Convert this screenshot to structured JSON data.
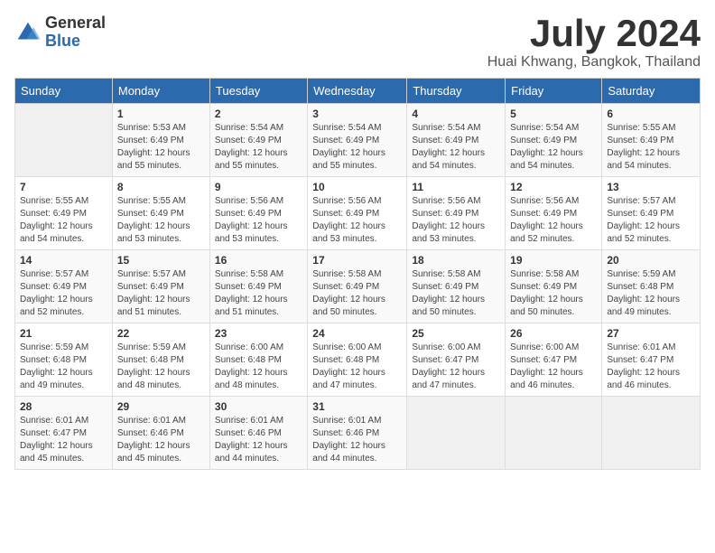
{
  "header": {
    "logo_general": "General",
    "logo_blue": "Blue",
    "month": "July 2024",
    "location": "Huai Khwang, Bangkok, Thailand"
  },
  "weekdays": [
    "Sunday",
    "Monday",
    "Tuesday",
    "Wednesday",
    "Thursday",
    "Friday",
    "Saturday"
  ],
  "weeks": [
    [
      {
        "day": "",
        "info": ""
      },
      {
        "day": "1",
        "info": "Sunrise: 5:53 AM\nSunset: 6:49 PM\nDaylight: 12 hours\nand 55 minutes."
      },
      {
        "day": "2",
        "info": "Sunrise: 5:54 AM\nSunset: 6:49 PM\nDaylight: 12 hours\nand 55 minutes."
      },
      {
        "day": "3",
        "info": "Sunrise: 5:54 AM\nSunset: 6:49 PM\nDaylight: 12 hours\nand 55 minutes."
      },
      {
        "day": "4",
        "info": "Sunrise: 5:54 AM\nSunset: 6:49 PM\nDaylight: 12 hours\nand 54 minutes."
      },
      {
        "day": "5",
        "info": "Sunrise: 5:54 AM\nSunset: 6:49 PM\nDaylight: 12 hours\nand 54 minutes."
      },
      {
        "day": "6",
        "info": "Sunrise: 5:55 AM\nSunset: 6:49 PM\nDaylight: 12 hours\nand 54 minutes."
      }
    ],
    [
      {
        "day": "7",
        "info": "Sunrise: 5:55 AM\nSunset: 6:49 PM\nDaylight: 12 hours\nand 54 minutes."
      },
      {
        "day": "8",
        "info": "Sunrise: 5:55 AM\nSunset: 6:49 PM\nDaylight: 12 hours\nand 53 minutes."
      },
      {
        "day": "9",
        "info": "Sunrise: 5:56 AM\nSunset: 6:49 PM\nDaylight: 12 hours\nand 53 minutes."
      },
      {
        "day": "10",
        "info": "Sunrise: 5:56 AM\nSunset: 6:49 PM\nDaylight: 12 hours\nand 53 minutes."
      },
      {
        "day": "11",
        "info": "Sunrise: 5:56 AM\nSunset: 6:49 PM\nDaylight: 12 hours\nand 53 minutes."
      },
      {
        "day": "12",
        "info": "Sunrise: 5:56 AM\nSunset: 6:49 PM\nDaylight: 12 hours\nand 52 minutes."
      },
      {
        "day": "13",
        "info": "Sunrise: 5:57 AM\nSunset: 6:49 PM\nDaylight: 12 hours\nand 52 minutes."
      }
    ],
    [
      {
        "day": "14",
        "info": "Sunrise: 5:57 AM\nSunset: 6:49 PM\nDaylight: 12 hours\nand 52 minutes."
      },
      {
        "day": "15",
        "info": "Sunrise: 5:57 AM\nSunset: 6:49 PM\nDaylight: 12 hours\nand 51 minutes."
      },
      {
        "day": "16",
        "info": "Sunrise: 5:58 AM\nSunset: 6:49 PM\nDaylight: 12 hours\nand 51 minutes."
      },
      {
        "day": "17",
        "info": "Sunrise: 5:58 AM\nSunset: 6:49 PM\nDaylight: 12 hours\nand 50 minutes."
      },
      {
        "day": "18",
        "info": "Sunrise: 5:58 AM\nSunset: 6:49 PM\nDaylight: 12 hours\nand 50 minutes."
      },
      {
        "day": "19",
        "info": "Sunrise: 5:58 AM\nSunset: 6:49 PM\nDaylight: 12 hours\nand 50 minutes."
      },
      {
        "day": "20",
        "info": "Sunrise: 5:59 AM\nSunset: 6:48 PM\nDaylight: 12 hours\nand 49 minutes."
      }
    ],
    [
      {
        "day": "21",
        "info": "Sunrise: 5:59 AM\nSunset: 6:48 PM\nDaylight: 12 hours\nand 49 minutes."
      },
      {
        "day": "22",
        "info": "Sunrise: 5:59 AM\nSunset: 6:48 PM\nDaylight: 12 hours\nand 48 minutes."
      },
      {
        "day": "23",
        "info": "Sunrise: 6:00 AM\nSunset: 6:48 PM\nDaylight: 12 hours\nand 48 minutes."
      },
      {
        "day": "24",
        "info": "Sunrise: 6:00 AM\nSunset: 6:48 PM\nDaylight: 12 hours\nand 47 minutes."
      },
      {
        "day": "25",
        "info": "Sunrise: 6:00 AM\nSunset: 6:47 PM\nDaylight: 12 hours\nand 47 minutes."
      },
      {
        "day": "26",
        "info": "Sunrise: 6:00 AM\nSunset: 6:47 PM\nDaylight: 12 hours\nand 46 minutes."
      },
      {
        "day": "27",
        "info": "Sunrise: 6:01 AM\nSunset: 6:47 PM\nDaylight: 12 hours\nand 46 minutes."
      }
    ],
    [
      {
        "day": "28",
        "info": "Sunrise: 6:01 AM\nSunset: 6:47 PM\nDaylight: 12 hours\nand 45 minutes."
      },
      {
        "day": "29",
        "info": "Sunrise: 6:01 AM\nSunset: 6:46 PM\nDaylight: 12 hours\nand 45 minutes."
      },
      {
        "day": "30",
        "info": "Sunrise: 6:01 AM\nSunset: 6:46 PM\nDaylight: 12 hours\nand 44 minutes."
      },
      {
        "day": "31",
        "info": "Sunrise: 6:01 AM\nSunset: 6:46 PM\nDaylight: 12 hours\nand 44 minutes."
      },
      {
        "day": "",
        "info": ""
      },
      {
        "day": "",
        "info": ""
      },
      {
        "day": "",
        "info": ""
      }
    ]
  ]
}
